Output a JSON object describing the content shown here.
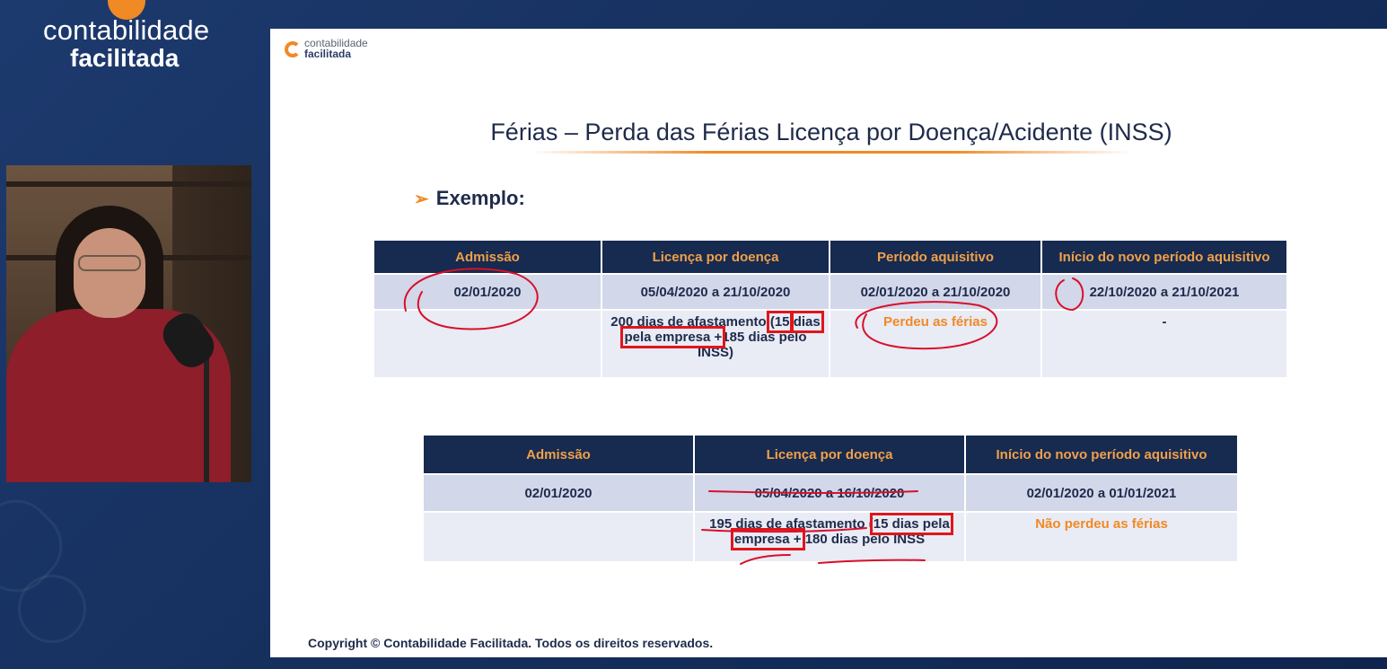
{
  "brand": {
    "line1": "contabilidade",
    "line2": "facilitada"
  },
  "slide": {
    "logo": {
      "line1": "contabilidade",
      "line2": "facilitada"
    },
    "title": "Férias – Perda das Férias Licença por Doença/Acidente (INSS)",
    "example_arrow": "➢",
    "example_label": "Exemplo:",
    "table1": {
      "headers": [
        "Admissão",
        "Licença por doença",
        "Período aquisitivo",
        "Início do novo período aquisitivo"
      ],
      "row1": [
        "02/01/2020",
        "05/04/2020 a 21/10/2020",
        "02/01/2020 a 21/10/2020",
        "22/10/2020 a 21/10/2021"
      ],
      "row2": {
        "admissao": "",
        "licenca_a": "200 dias de afastamento ",
        "licenca_hl1": "(15",
        "licenca_hl2": "dias pela empresa +",
        "licenca_b": "185 dias pelo INSS)",
        "periodo": "Perdeu as férias",
        "inicio": "-"
      }
    },
    "table2": {
      "headers": [
        "Admissão",
        "Licença por doença",
        "Início do novo período aquisitivo"
      ],
      "row1": [
        "02/01/2020",
        "05/04/2020 a 16/10/2020",
        "02/01/2020 a 01/01/2021"
      ],
      "row2": {
        "admissao": "",
        "licenca_a": "195 dias de afastamento (",
        "licenca_hl1": "15 dias pela",
        "licenca_hl2": "empresa +",
        "licenca_b": "180 dias pelo INSS",
        "inicio": "Não perdeu as férias"
      }
    },
    "copyright": "Copyright © Contabilidade Facilitada. Todos os direitos reservados."
  },
  "colors": {
    "header_bg": "#172a4f",
    "header_text": "#f0a04a",
    "accent": "#f08a24",
    "highlight_box": "#e0161b",
    "annotation_ink": "#d8102a"
  }
}
